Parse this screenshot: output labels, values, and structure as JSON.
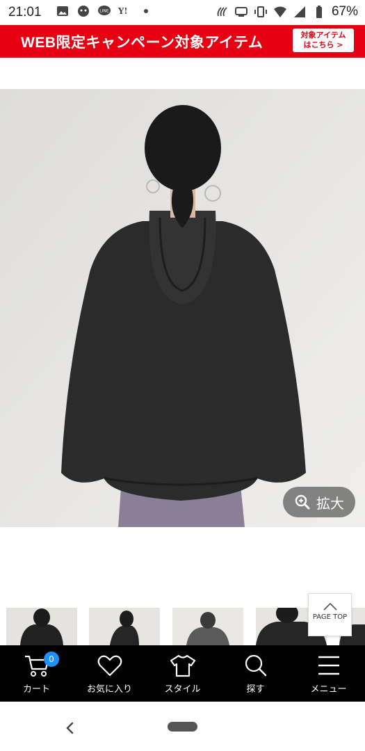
{
  "status_bar": {
    "time": "21:01",
    "battery": "67%"
  },
  "banner": {
    "title": "WEB限定キャンペーン対象アイテム",
    "cta_line1": "対象アイテム",
    "cta_line2": "はこちら >"
  },
  "zoom": {
    "label": "拡大"
  },
  "page_top": {
    "label": "PAGE TOP"
  },
  "bottom_nav": {
    "cart_label": "カート",
    "cart_count": "0",
    "favorites_label": "お気に入り",
    "style_label": "スタイル",
    "search_label": "探す",
    "menu_label": "メニュー"
  }
}
